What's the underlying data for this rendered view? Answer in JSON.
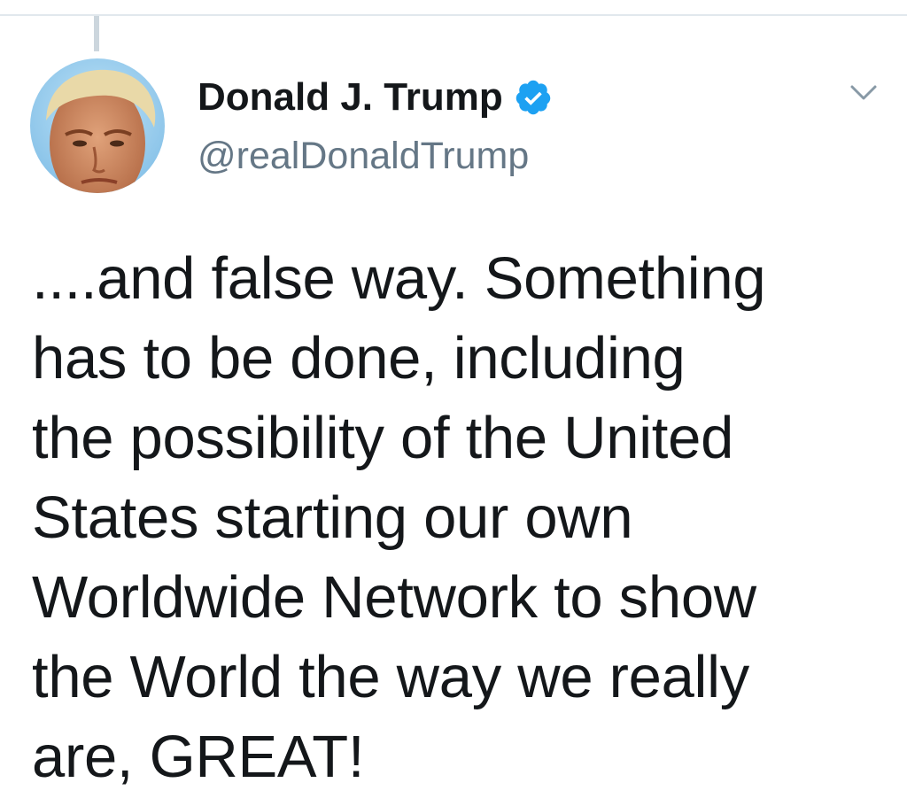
{
  "tweet": {
    "author": {
      "display_name": "Donald J. Trump",
      "handle": "@realDonaldTrump",
      "verified": true,
      "avatar_icon": "profile-photo",
      "verified_icon": "verified-badge-icon"
    },
    "menu_icon": "chevron-down-icon",
    "text_lines": [
      "....and false way. Something",
      "has to be done, including",
      "the possibility of the United",
      "States starting our own",
      "Worldwide Network to show",
      "the World the way we really",
      "are, GREAT!"
    ]
  },
  "colors": {
    "text_primary": "#14171a",
    "text_secondary": "#657786",
    "verified_blue": "#1da1f2",
    "divider": "#e1e8ed",
    "thread_line": "#ccd6dd"
  }
}
